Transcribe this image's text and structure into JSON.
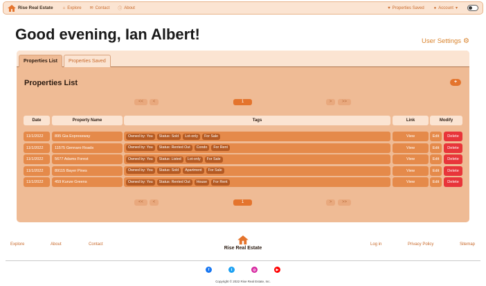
{
  "navbar": {
    "brand": "Rise Real Estate",
    "links": [
      {
        "label": "Explore",
        "icon": "house-icon"
      },
      {
        "label": "Contact",
        "icon": "envelope-icon"
      },
      {
        "label": "About",
        "icon": "info-icon"
      }
    ],
    "saved_label": "Properties Saved",
    "account_label": "Account",
    "caret": "▾"
  },
  "greeting": "Good evening, Ian Albert!",
  "user_settings": "User Settings",
  "tabs": [
    {
      "label": "Properties List",
      "active": true
    },
    {
      "label": "Properties Saved",
      "active": false
    }
  ],
  "section_title": "Properties List",
  "add_label": "+",
  "pagination": {
    "first": "<<",
    "prev": "<",
    "current": "1",
    "next": ">",
    "last": ">>"
  },
  "table": {
    "headers": [
      "Date",
      "Property Name",
      "Tags",
      "Link",
      "Modify"
    ],
    "rows": [
      {
        "date": "11/1/2022",
        "name": "895 Gia Expressway",
        "tags": [
          "Owned by: You",
          "Status: Sold",
          "Lot-only",
          "For Sale"
        ],
        "link": "View",
        "edit": "Edit",
        "delete": "Delete"
      },
      {
        "date": "11/1/2022",
        "name": "11575 Gennaro Roads",
        "tags": [
          "Owned by: You",
          "Status: Rented Out",
          "Condo",
          "For Rent"
        ],
        "link": "View",
        "edit": "Edit",
        "delete": "Delete"
      },
      {
        "date": "11/1/2022",
        "name": "5677 Adams Forest",
        "tags": [
          "Owned by: You",
          "Status: Listed",
          "Lot-only",
          "For Sale"
        ],
        "link": "View",
        "edit": "Edit",
        "delete": "Delete"
      },
      {
        "date": "11/1/2022",
        "name": "89115 Bayer Pines",
        "tags": [
          "Owned by: You",
          "Status: Sold",
          "Apartment",
          "For Sale"
        ],
        "link": "View",
        "edit": "Edit",
        "delete": "Delete"
      },
      {
        "date": "11/1/2022",
        "name": "459 Kunze Greens",
        "tags": [
          "Owned by: You",
          "Status: Rented Out",
          "House",
          "For Rent"
        ],
        "link": "View",
        "edit": "Edit",
        "delete": "Delete"
      }
    ]
  },
  "footer": {
    "left_links": [
      "Explore",
      "About",
      "Contact"
    ],
    "brand": "Rise Real Estate",
    "right_links": [
      "Log in",
      "Privacy Policy",
      "Sitemap"
    ],
    "social": [
      {
        "icon": "facebook-icon",
        "glyph": "f",
        "color": "#1877f2"
      },
      {
        "icon": "twitter-icon",
        "glyph": "t",
        "color": "#1da1f2"
      },
      {
        "icon": "instagram-icon",
        "glyph": "◎",
        "color": "#d6249f"
      },
      {
        "icon": "youtube-icon",
        "glyph": "▶",
        "color": "#ff0000"
      }
    ],
    "copyright": "Copyright © 2022 Rise Real Estate, Inc."
  },
  "colors": {
    "accent": "#e4742d",
    "panel": "#efbb95",
    "row": "#e58a4a",
    "tag": "#b45a23",
    "delete": "#e8353a",
    "link": "#c8692a"
  }
}
